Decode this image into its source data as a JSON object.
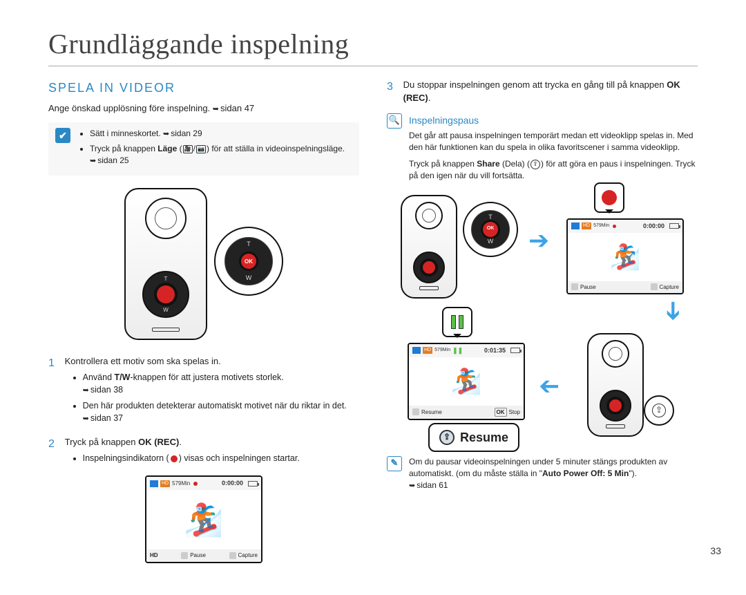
{
  "page": {
    "title": "Grundläggande inspelning",
    "number": "33"
  },
  "left": {
    "section": "SPELA IN VIDEOR",
    "intro_a": "Ange önskad upplösning före inspelning. ",
    "intro_ref": "sidan 47",
    "precheck": {
      "item1_a": "Sätt i minneskortet. ",
      "item1_ref": "sidan 29",
      "item2_a": "Tryck på knappen ",
      "item2_b": "Läge",
      "item2_c": " (",
      "item2_d": ") för att ställa in videoinspelningsläge. ",
      "item2_ref": "sidan 25"
    },
    "callout": {
      "ok": "OK",
      "t": "T",
      "w": "W"
    },
    "step1": {
      "num": "1",
      "text": "Kontrollera ett motiv som ska spelas in.",
      "sub1_a": "Använd ",
      "sub1_b": "T/W",
      "sub1_c": "-knappen för att justera motivets storlek. ",
      "sub1_ref": "sidan 38",
      "sub2_a": "Den här produkten detekterar automatiskt motivet när du riktar in det. ",
      "sub2_ref": "sidan 37"
    },
    "step2": {
      "num": "2",
      "text_a": "Tryck på knappen ",
      "text_b": "OK (REC)",
      "text_c": ".",
      "sub1_a": "Inspelningsindikatorn (",
      "sub1_b": ") visas och inspelningen startar."
    },
    "screen1": {
      "min": "579Min",
      "time": "0:00:00",
      "hd": "HD",
      "pause": "Pause",
      "capture": "Capture"
    }
  },
  "right": {
    "step3": {
      "num": "3",
      "text_a": "Du stoppar inspelningen genom att trycka en gång till på knappen ",
      "text_b": "OK (REC)",
      "text_c": "."
    },
    "subhead": "Inspelningspaus",
    "pause_p1": "Det går att pausa inspelningen temporärt medan ett videoklipp spelas in. Med den här funktionen kan du spela in olika favoritscener i samma videoklipp.",
    "pause_p2_a": "Tryck på knappen ",
    "pause_p2_b": "Share",
    "pause_p2_c": " (Dela) (",
    "pause_p2_d": ") för att göra en paus i inspelningen. Tryck på den igen när du vill fortsätta.",
    "callout": {
      "ok": "OK",
      "t": "T",
      "w": "W"
    },
    "screen_rec": {
      "min": "579Min",
      "time": "0:00:00",
      "pause": "Pause",
      "capture": "Capture"
    },
    "screen_paused": {
      "min": "579Min",
      "time": "0:01:35",
      "resume": "Resume",
      "stop_a": "OK",
      "stop_b": "Stop"
    },
    "resume_label": "Resume",
    "note_a": "Om du pausar videoinspelningen under 5 minuter stängs produkten av automatiskt. (om du måste ställa in \"",
    "note_b": "Auto Power Off: 5 Min",
    "note_c": "\"). ",
    "note_ref": "sidan 61"
  }
}
